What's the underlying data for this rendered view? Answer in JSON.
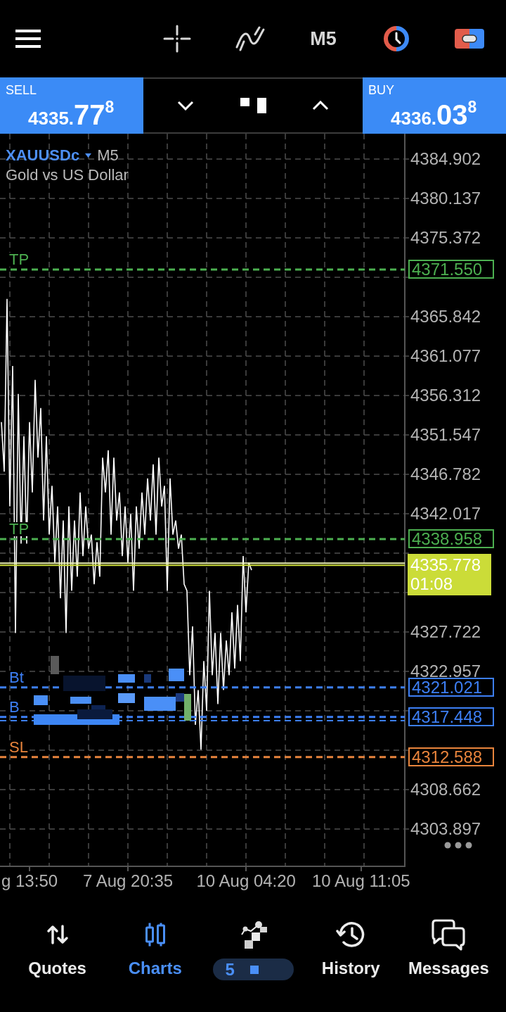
{
  "toolbar": {
    "timeframe": "M5"
  },
  "trade_bar": {
    "sell": {
      "label": "SELL",
      "price_prefix": "4335.",
      "price_pips": "77",
      "price_point": "8"
    },
    "buy": {
      "label": "BUY",
      "price_prefix": "4336.",
      "price_pips": "03",
      "price_point": "8"
    }
  },
  "chart": {
    "symbol": "XAUUSDc",
    "timeframe": "M5",
    "description": "Gold vs US Dollar",
    "chart_data": {
      "type": "line",
      "grid": true,
      "categories": [
        null,
        null,
        null,
        null,
        null,
        null,
        null,
        null,
        null,
        null,
        "g 13:50",
        null,
        null,
        null,
        null,
        null,
        null,
        null,
        null,
        null,
        null,
        null,
        null,
        null,
        null,
        null,
        null,
        null,
        null,
        null,
        null,
        null,
        null,
        null,
        null,
        null,
        null,
        null,
        null,
        null,
        null,
        null,
        null,
        null,
        null,
        "7 Aug 20:35",
        null,
        null,
        null,
        null,
        null,
        null,
        null,
        null,
        null,
        null,
        null,
        null,
        null,
        null,
        null,
        null,
        null,
        null,
        null,
        null,
        null,
        null,
        null,
        null,
        null,
        null,
        null,
        null,
        null,
        null,
        null,
        null,
        null,
        null,
        null,
        null,
        null,
        null,
        null,
        null,
        null,
        "10 Aug 04:20",
        null,
        null,
        null,
        null,
        null,
        null,
        null,
        null,
        null,
        null,
        null,
        null,
        null,
        null,
        null,
        null,
        null,
        null,
        null,
        null,
        null,
        null,
        null,
        null,
        null,
        null,
        null,
        null,
        null,
        null,
        null,
        null,
        null,
        null,
        null,
        null,
        null,
        null,
        null,
        null,
        "10 Aug 11:05",
        null,
        null,
        null,
        null,
        null,
        null,
        null,
        null,
        null,
        null,
        null,
        null,
        null,
        null,
        null
      ],
      "ylim": [
        4299.3,
        4387.97
      ],
      "yticks": [
        4384.902,
        4380.137,
        4375.372,
        4365.842,
        4361.077,
        4356.312,
        4351.547,
        4346.782,
        4342.017,
        4327.722,
        4322.957,
        4308.662,
        4303.897
      ],
      "series": [
        {
          "color": "#ffffff",
          "values": [
            4353.1,
            4347.1,
            4368.0,
            4342.9,
            4359.9,
            4327.6,
            4356.5,
            4338.4,
            4351.4,
            4338.4,
            4353.1,
            4344.6,
            4358.2,
            4348.8,
            4354.8,
            4341.2,
            4351.4,
            4339.5,
            4345.4,
            4336.1,
            4342.9,
            4331.8,
            4341.2,
            4327.6,
            4342.9,
            4332.7,
            4341.2,
            4334.4,
            4344.6,
            4336.9,
            4342.9,
            4337.8,
            4339.5,
            4333.5,
            4338.6,
            4334.4,
            4348.8,
            4344.6,
            4349.7,
            4339.5,
            4348.8,
            4341.2,
            4344.6,
            4336.9,
            4342.9,
            4336.1,
            4342.0,
            4332.7,
            4342.9,
            4337.8,
            4344.6,
            4339.5,
            4346.3,
            4341.2,
            4348.0,
            4339.5,
            4348.8,
            4342.9,
            4345.4,
            4332.7,
            4346.3,
            4339.5,
            4341.2,
            4337.8,
            4339.5,
            4333.5,
            4332.7,
            4322.5,
            4328.4,
            4316.5,
            4320.7,
            4313.5,
            4324.2,
            4318.2,
            4332.7,
            4322.5,
            4327.6,
            4319.0,
            4327.6,
            4320.7,
            4326.7,
            4322.5,
            4330.1,
            4323.3,
            4331.0,
            4324.2,
            4336.9,
            4330.1,
            4336.1,
            4335.2,
            null,
            null,
            null,
            null,
            null,
            null,
            null,
            null,
            null,
            null,
            null,
            null,
            null,
            null,
            null,
            null,
            null,
            null,
            null,
            null,
            null,
            null,
            null,
            null,
            null,
            null,
            null,
            null,
            null,
            null,
            null,
            null,
            null,
            null,
            null,
            null,
            null,
            null,
            null,
            null,
            null,
            null,
            null,
            null,
            null,
            null,
            null,
            null,
            null,
            null,
            null,
            null,
            null,
            null
          ]
        }
      ],
      "ref_lines": [
        {
          "axis": "y",
          "value": 4371.55,
          "label": "TP",
          "color": "#4caf50"
        },
        {
          "axis": "y",
          "value": 4338.958,
          "label": "TP",
          "color": "#4caf50"
        },
        {
          "axis": "y",
          "value": 4336.038,
          "color": "#eef3b5"
        },
        {
          "axis": "y",
          "value": 4335.778,
          "color": "#cbdc38"
        },
        {
          "axis": "y",
          "value": 4321.021,
          "label": "Bt",
          "color": "#3d7ff5"
        },
        {
          "axis": "y",
          "value": 4317.448,
          "label": "B",
          "color": "#3d7ff5"
        },
        {
          "axis": "y",
          "value": 4317.0,
          "color": "#3d7ff5"
        },
        {
          "axis": "y",
          "value": 4312.588,
          "label": "SL",
          "color": "#e8843c"
        }
      ]
    },
    "price_tags": [
      {
        "kind": "outlined",
        "text": "4371.550",
        "color": "#4caf50"
      },
      {
        "kind": "outlined",
        "text": "4338.958",
        "color": "#4caf50"
      },
      {
        "kind": "filled",
        "text": "4335.778",
        "time": "01:08",
        "color": "#cbdc38"
      },
      {
        "kind": "outlined",
        "text": "4321.021",
        "color": "#3d7ff5"
      },
      {
        "kind": "outlined",
        "text": "4317.448",
        "color": "#3d7ff5"
      },
      {
        "kind": "outlined",
        "text": "4312.588",
        "color": "#e8843c"
      }
    ]
  },
  "tabs": [
    {
      "kind": "tab",
      "label": "Quotes",
      "selected": false
    },
    {
      "kind": "tab",
      "label": "Charts",
      "selected": true
    },
    {
      "kind": "pixelated",
      "badge": "5",
      "selected": false
    },
    {
      "kind": "tab",
      "label": "History",
      "selected": false
    },
    {
      "kind": "tab",
      "label": "Messages",
      "selected": false
    }
  ]
}
